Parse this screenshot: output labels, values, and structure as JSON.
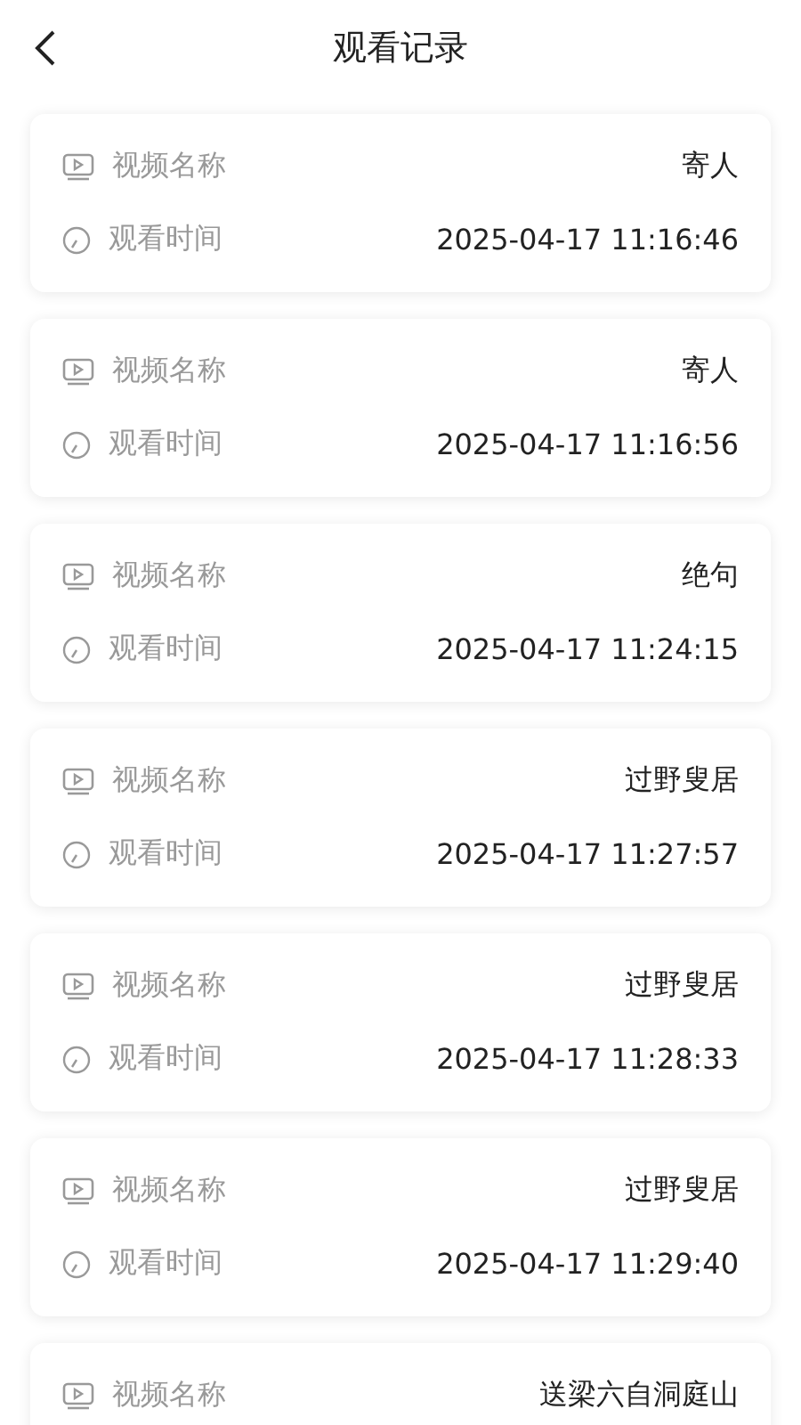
{
  "header": {
    "title": "观看记录"
  },
  "records": [
    {
      "name_label": "视频名称",
      "name": "寄人",
      "time_label": "观看时间",
      "time": "2025-04-17 11:16:46"
    },
    {
      "name_label": "视频名称",
      "name": "寄人",
      "time_label": "观看时间",
      "time": "2025-04-17 11:16:56"
    },
    {
      "name_label": "视频名称",
      "name": "绝句",
      "time_label": "观看时间",
      "time": "2025-04-17 11:24:15"
    },
    {
      "name_label": "视频名称",
      "name": "过野叟居",
      "time_label": "观看时间",
      "time": "2025-04-17 11:27:57"
    },
    {
      "name_label": "视频名称",
      "name": "过野叟居",
      "time_label": "观看时间",
      "time": "2025-04-17 11:28:33"
    },
    {
      "name_label": "视频名称",
      "name": "过野叟居",
      "time_label": "观看时间",
      "time": "2025-04-17 11:29:40"
    },
    {
      "name_label": "视频名称",
      "name": "送梁六自洞庭山"
    }
  ]
}
